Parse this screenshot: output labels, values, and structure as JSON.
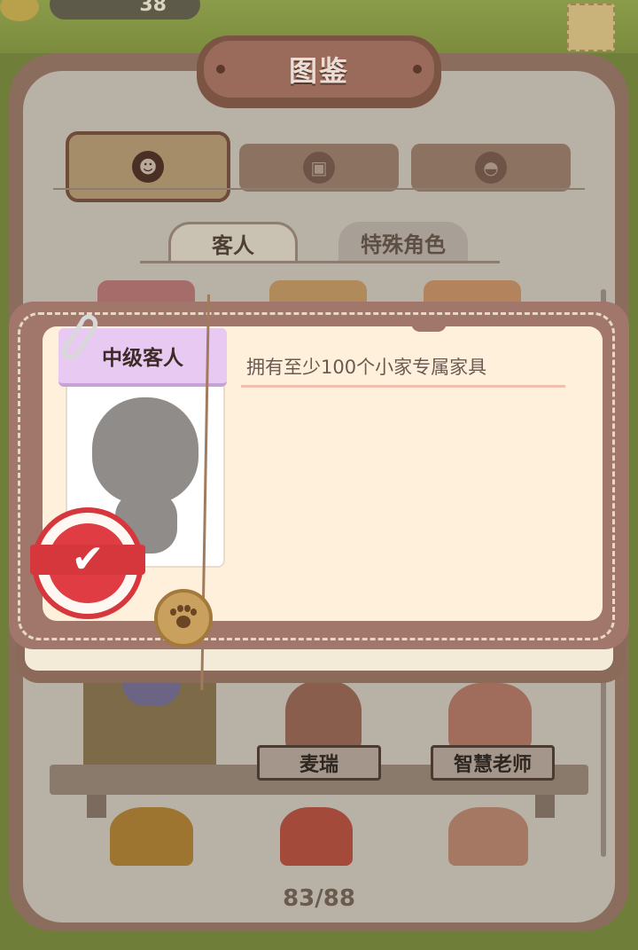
{
  "hud": {
    "coin_count": "38"
  },
  "title": "图鉴",
  "category_tabs": [
    {
      "icon": "skull-face-icon",
      "active": true
    },
    {
      "icon": "gift-box-icon",
      "active": false
    },
    {
      "icon": "dome-icon",
      "active": false
    }
  ],
  "sub_tabs": [
    {
      "label": "客人",
      "active": true
    },
    {
      "label": "特殊角色",
      "active": false
    }
  ],
  "popup": {
    "level_label": "中级客人",
    "requirement": "拥有至少100个小家专属家具",
    "stamp_state": "unlocked-check"
  },
  "shelf_characters": [
    {
      "name": "麦瑞"
    },
    {
      "name": "智慧老师"
    }
  ],
  "page_indicator": "83/88"
}
